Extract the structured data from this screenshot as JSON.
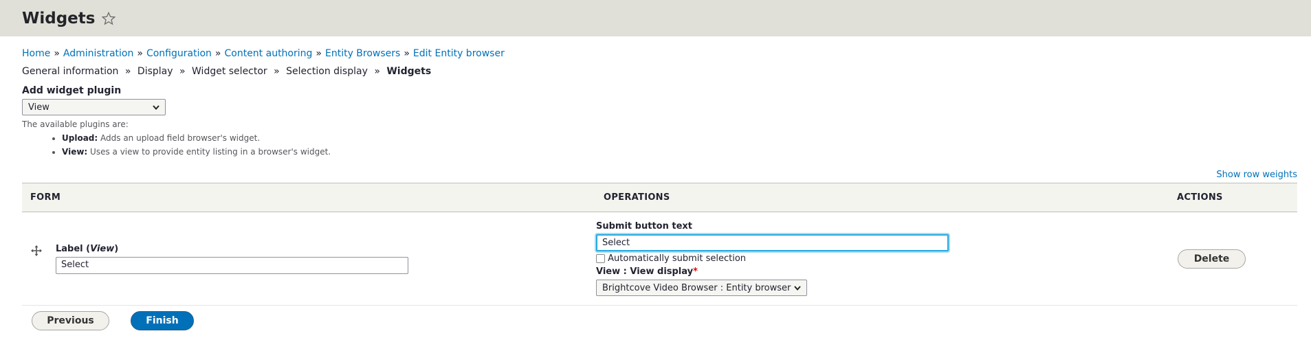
{
  "page": {
    "title": "Widgets"
  },
  "breadcrumb": [
    {
      "label": "Home"
    },
    {
      "label": "Administration"
    },
    {
      "label": "Configuration"
    },
    {
      "label": "Content authoring"
    },
    {
      "label": "Entity Browsers"
    },
    {
      "label": "Edit Entity browser"
    }
  ],
  "breadcrumb_separator": "»",
  "steps": {
    "items": [
      "General information",
      "Display",
      "Widget selector",
      "Selection display"
    ],
    "current": "Widgets"
  },
  "add_widget": {
    "label": "Add widget plugin",
    "selected": "View",
    "description": "The available plugins are:",
    "plugins": [
      {
        "name": "Upload:",
        "text": "Adds an upload field browser's widget."
      },
      {
        "name": "View:",
        "text": "Uses a view to provide entity listing in a browser's widget."
      }
    ]
  },
  "show_row_weights": "Show row weights",
  "table": {
    "headers": [
      "FORM",
      "OPERATIONS",
      "ACTIONS"
    ],
    "row": {
      "label_prefix": "Label (",
      "label_em": "View",
      "label_suffix": ")",
      "label_value": "Select",
      "submit_label": "Submit button text",
      "submit_value": "Select",
      "auto_submit_label": "Automatically submit selection",
      "view_label": "View : View display",
      "required_mark": "*",
      "view_selected": "Brightcove Video Browser : Entity browser",
      "delete_label": "Delete"
    }
  },
  "footer": {
    "previous": "Previous",
    "finish": "Finish"
  },
  "colors": {
    "link": "#0071b8",
    "primary_button": "#0071b8",
    "header_bg": "#e0e0d8",
    "focus": "#26a9e0",
    "required": "#e00000"
  },
  "icons": {
    "star": "star-icon",
    "chevron": "chevron-down-icon",
    "drag": "drag-handle-icon"
  }
}
